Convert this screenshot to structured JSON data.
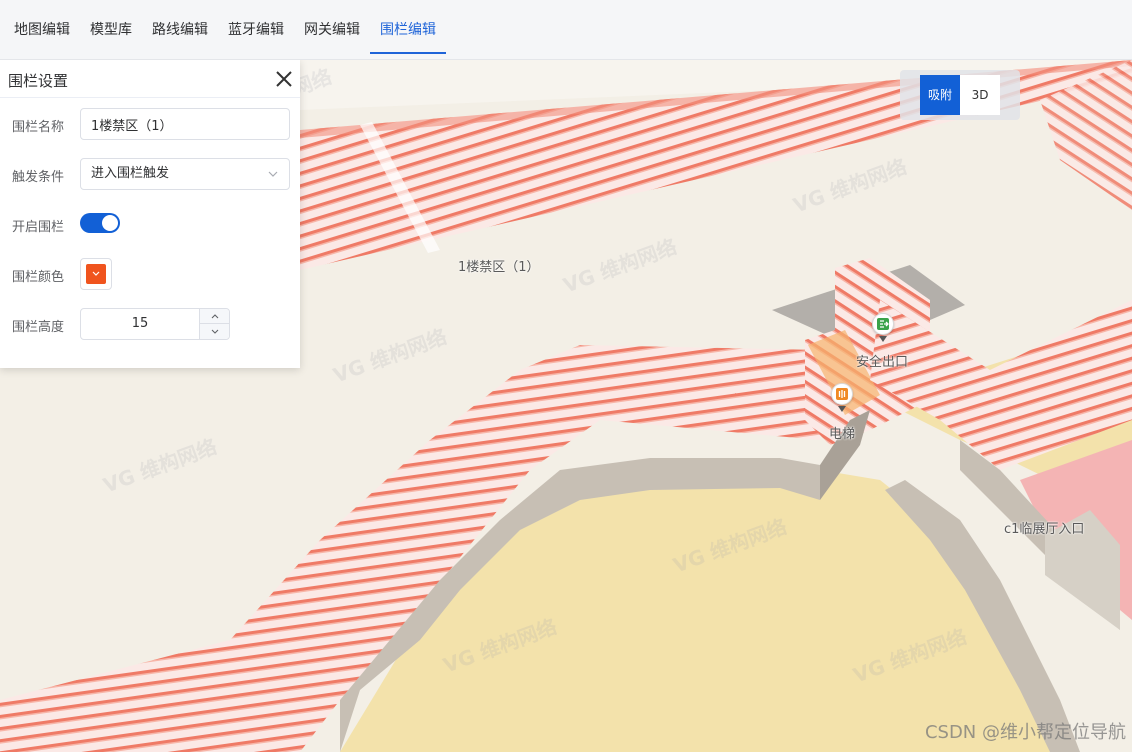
{
  "tabs": [
    {
      "label": "地图编辑",
      "active": false
    },
    {
      "label": "模型库",
      "active": false
    },
    {
      "label": "路线编辑",
      "active": false
    },
    {
      "label": "蓝牙编辑",
      "active": false
    },
    {
      "label": "网关编辑",
      "active": false
    },
    {
      "label": "围栏编辑",
      "active": true
    }
  ],
  "panel": {
    "title": "围栏设置",
    "close_icon": "close-icon",
    "name_label": "围栏名称",
    "name_value": "1楼禁区（1）",
    "trigger_label": "触发条件",
    "trigger_value": "进入围栏触发",
    "enable_label": "开启围栏",
    "enabled": true,
    "color_label": "围栏颜色",
    "color_value": "#f0541e",
    "height_label": "围栏高度",
    "height_value": "15"
  },
  "mode_toggle": {
    "snap_label": "吸附",
    "three_d_label": "3D",
    "active": "吸附"
  },
  "map": {
    "fence_label": "1楼禁区（1）",
    "poi_exit_label": "安全出口",
    "poi_elevator_label": "电梯",
    "poi_hall_label": "c1临展厅入口",
    "watermark_text": "VG 维构网络"
  },
  "credit": "CSDN @维小帮定位导航",
  "colors": {
    "accent": "#1260d6",
    "fence": "#f0541e",
    "floor": "#f3efe6",
    "room": "#f3e2ab",
    "wall": "#bdb5aa"
  }
}
